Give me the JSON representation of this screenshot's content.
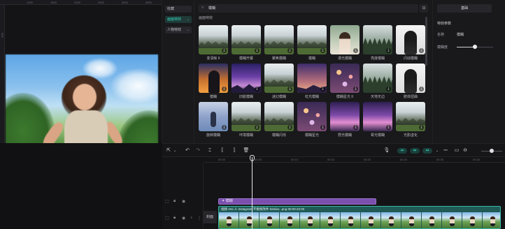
{
  "preview": {
    "ruler_marks": [
      "1000",
      "1500",
      "2000",
      "2500",
      "3000",
      "3500"
    ],
    "vertical_ruler_mark": "500"
  },
  "categories": [
    {
      "label": "收藏",
      "active": false,
      "has_arrow": false
    },
    {
      "label": "画面特效",
      "active": true,
      "has_arrow": true
    },
    {
      "label": "人物特效",
      "active": false,
      "has_arrow": true
    }
  ],
  "library": {
    "search_value": "模糊",
    "section_title": "画面特效",
    "effects": [
      {
        "label": "变清晰 II",
        "thumb": "mist"
      },
      {
        "label": "模糊开幕",
        "thumb": "mist"
      },
      {
        "label": "聚焦模糊",
        "thumb": "mist"
      },
      {
        "label": "模糊",
        "thumb": "mist"
      },
      {
        "label": "漫光模糊",
        "thumb": "portrait"
      },
      {
        "label": "亮度模糊",
        "thumb": "forest"
      },
      {
        "label": "闪动模糊",
        "thumb": "bw"
      },
      {
        "label": "模糊",
        "thumb": "sunset"
      },
      {
        "label": "旧胶模糊",
        "thumb": "galaxy"
      },
      {
        "label": "迷幻模糊",
        "thumb": "mist"
      },
      {
        "label": "虹光模糊",
        "thumb": "night"
      },
      {
        "label": "模糊星光 II",
        "thumb": "lights"
      },
      {
        "label": "天地无边",
        "thumb": "forest"
      },
      {
        "label": "肢体扭曲",
        "thumb": "bw"
      },
      {
        "label": "旋转模糊",
        "thumb": "sea"
      },
      {
        "label": "环境模糊",
        "thumb": "mist"
      },
      {
        "label": "模糊闪烁",
        "thumb": "mist"
      },
      {
        "label": "模糊星光",
        "thumb": "lights"
      },
      {
        "label": "霓光模糊",
        "thumb": "city"
      },
      {
        "label": "晕光模糊",
        "thumb": "city"
      },
      {
        "label": "光影虚化",
        "thumb": "mist"
      }
    ]
  },
  "inspector": {
    "tab_label": "基础",
    "section_title": "特效参数",
    "name_label": "名称",
    "name_value": "模糊",
    "blur_label": "模糊度",
    "blur_level_percent": 50
  },
  "toolbar": {
    "icons": [
      "select-arrow",
      "undo",
      "redo",
      "split",
      "split-left",
      "split-right",
      "delete"
    ]
  },
  "timeline": {
    "ruler_marks": [
      "00:00",
      "00:05",
      "00:10",
      "00:15",
      "00:20",
      "00:25",
      "00:30",
      "00:35"
    ],
    "effect_clip_label": "模糊",
    "main_clip_caption": "视频  2mi  人  Instagram  不要修改件  Similar...png  00:00:22:00",
    "cover_label": "封面"
  }
}
